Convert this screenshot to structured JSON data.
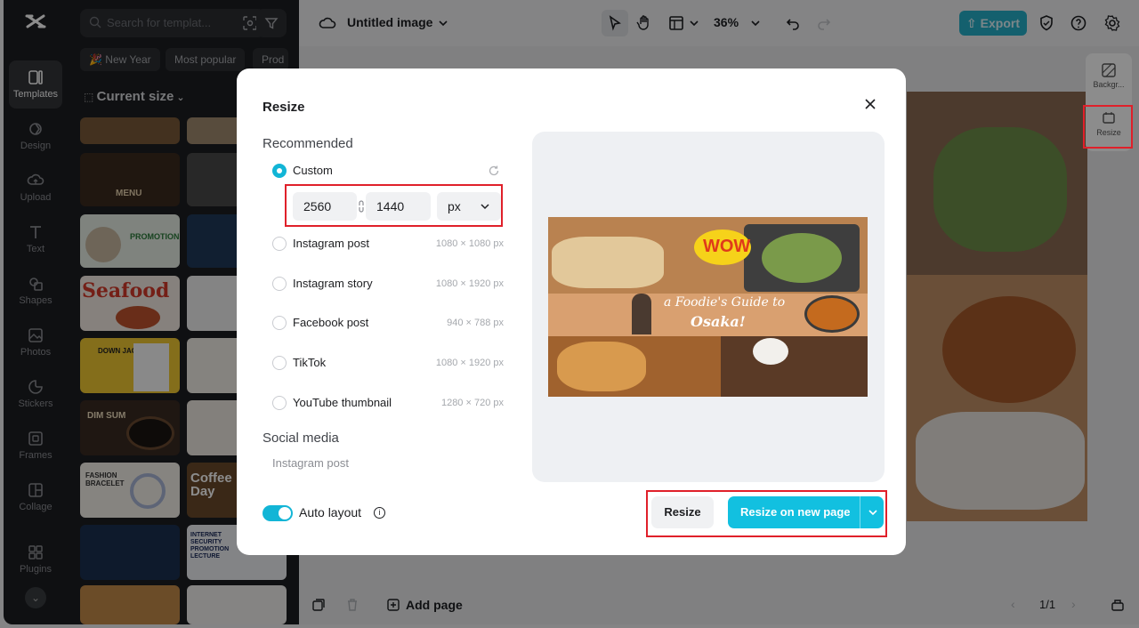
{
  "rail": {
    "items": [
      {
        "label": "Templates",
        "icon": "templates-icon"
      },
      {
        "label": "Design",
        "icon": "design-icon"
      },
      {
        "label": "Upload",
        "icon": "upload-icon"
      },
      {
        "label": "Text",
        "icon": "text-icon"
      },
      {
        "label": "Shapes",
        "icon": "shapes-icon"
      },
      {
        "label": "Photos",
        "icon": "photos-icon"
      },
      {
        "label": "Stickers",
        "icon": "stickers-icon"
      },
      {
        "label": "Frames",
        "icon": "frames-icon"
      },
      {
        "label": "Collage",
        "icon": "collage-icon"
      },
      {
        "label": "Plugins",
        "icon": "plugins-icon"
      }
    ]
  },
  "panel": {
    "search_placeholder": "Search for templat...",
    "chips": [
      "🎉 New Year",
      "Most popular",
      "Prod"
    ],
    "current_size": "Current size",
    "thumbnails": [
      "MENU",
      "PROMOTION",
      "Seafood",
      "DOWN JACKET",
      "DIM SUM",
      "FASHION BRACELET",
      "Coffee Day",
      "INTERNET SECURITY PROMOTION LECTURE"
    ]
  },
  "topbar": {
    "title": "Untitled image",
    "zoom": "36%",
    "export_label": "Export"
  },
  "right_tools": {
    "background_label": "Backgr...",
    "resize_label": "Resize"
  },
  "bottombar": {
    "add_page": "Add page",
    "page_indicator": "1/1"
  },
  "modal": {
    "title": "Resize",
    "recommended_heading": "Recommended",
    "custom_label": "Custom",
    "width": "2560",
    "height": "1440",
    "unit": "px",
    "presets": [
      {
        "label": "Instagram post",
        "dims": "1080 × 1080 px"
      },
      {
        "label": "Instagram story",
        "dims": "1080 × 1920 px"
      },
      {
        "label": "Facebook post",
        "dims": "940 × 788 px"
      },
      {
        "label": "TikTok",
        "dims": "1080 × 1920 px"
      },
      {
        "label": "YouTube thumbnail",
        "dims": "1280 × 720 px"
      }
    ],
    "social_heading": "Social media",
    "social_item": "Instagram post",
    "auto_layout_label": "Auto layout",
    "resize_button": "Resize",
    "resize_new_page_button": "Resize on new page",
    "preview_text_wow": "WOW",
    "preview_text_guide": "a Foodie's Guide to",
    "preview_text_city": "Osaka!"
  },
  "colors": {
    "accent": "#12c0e0",
    "highlight_box": "#e0202a",
    "dark_panel": "#1d1e21"
  }
}
